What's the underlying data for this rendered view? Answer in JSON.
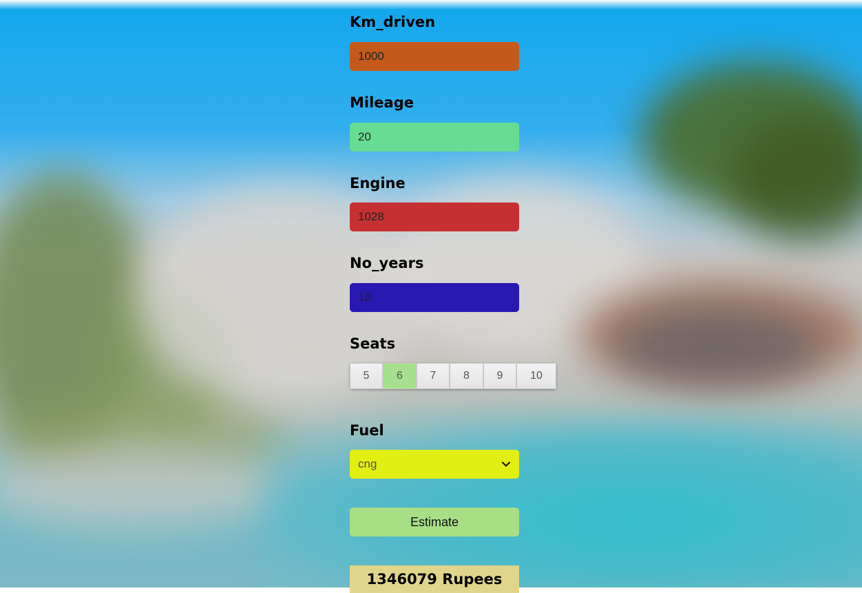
{
  "form": {
    "km_driven": {
      "label": "Km_driven",
      "value": "1000",
      "color": "#c35a1c"
    },
    "mileage": {
      "label": "Mileage",
      "value": "20",
      "color": "#67dc92"
    },
    "engine": {
      "label": "Engine",
      "value": "1028",
      "color": "#c53133"
    },
    "no_years": {
      "label": "No_years",
      "value": "10",
      "color": "#2819b1"
    },
    "seats": {
      "label": "Seats",
      "options": [
        "5",
        "6",
        "7",
        "8",
        "9",
        "10"
      ],
      "selected": "6",
      "selected_color": "#a6e08e"
    },
    "fuel": {
      "label": "Fuel",
      "selected": "cng",
      "color": "#e2ef12"
    },
    "estimate_button": {
      "label": "Estimate",
      "color": "#a8de86"
    },
    "result": {
      "text": "1346079 Rupees",
      "color": "#e0d58a"
    }
  }
}
